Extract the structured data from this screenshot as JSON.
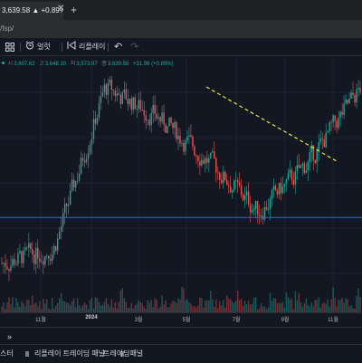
{
  "browser": {
    "tab_title": "3,639.58 ▲ +0.89%",
    "tab_close": "✕",
    "new_tab": "+",
    "url": "/fsp/"
  },
  "toolbar": {
    "layout_icon": "layout-grid-icon",
    "alert_label": "얼럿",
    "replay_label": "리플레이",
    "undo": "↶",
    "redo": "↷"
  },
  "legend": {
    "open_label": "시",
    "open_value": "3,607.62",
    "high_label": "고",
    "high_value": "3,648.10",
    "low_label": "저",
    "low_value": "3,573.97",
    "close_label": "종",
    "close_value": "3,639.58",
    "change": "+31.96 (+0.89%)"
  },
  "colors": {
    "up": "#26a69a",
    "down": "#ef5350",
    "horizontal_line": "#2962ff",
    "trend_line": "#f0e442",
    "background": "#131722"
  },
  "xaxis": [
    {
      "label": "11월",
      "bold": false
    },
    {
      "label": "2024",
      "bold": true
    },
    {
      "label": "3월",
      "bold": false
    },
    {
      "label": "5월",
      "bold": false
    },
    {
      "label": "7월",
      "bold": false
    },
    {
      "label": "9월",
      "bold": false
    },
    {
      "label": "11월",
      "bold": false
    }
  ],
  "bottom": {
    "item1": "스터",
    "item2": "리플레이 트레이딩 패널",
    "item3": "트레이딩패널"
  },
  "chart_data": {
    "type": "candlestick",
    "x": [
      "11월",
      "2024",
      "3월",
      "5월",
      "7월",
      "9월",
      "11월"
    ],
    "series": [
      {
        "values": [
          1.2,
          1.4,
          3.6,
          3.2,
          2.6,
          1.9,
          2.6,
          3.6
        ]
      }
    ],
    "horizontal_line_level": 0.63,
    "trend_line_from": [
      0.57,
      0.88
    ],
    "trend_line_to": [
      0.93,
      0.59
    ],
    "volume": true,
    "grid": true
  }
}
